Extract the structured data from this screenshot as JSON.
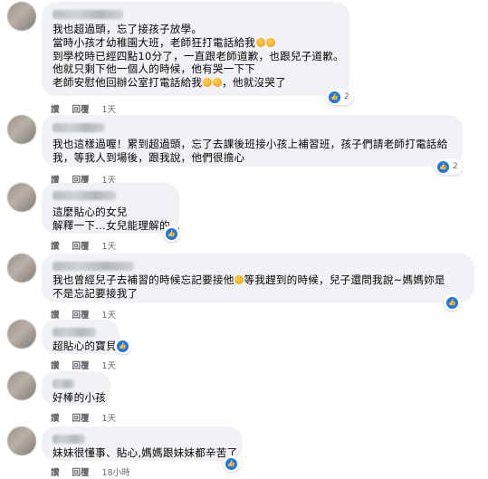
{
  "comments": [
    {
      "lines": [
        "我也超過頭，忘了接孩子放學。",
        "當時小孩才幼稚園大班，老師狂打電話給我",
        "到學校時已經四點10分了，一直跟老師道歉，也跟兒子道歉。",
        "他就只剩下他一個人的時候，他有哭一下下",
        "老師安慰他回辦公室打電話給我"
      ],
      "line_suffix": [
        "",
        "",
        "",
        "",
        "，他就沒哭了"
      ],
      "emoji_counts": [
        0,
        2,
        0,
        0,
        2
      ],
      "reaction_count": "2",
      "actions": {
        "like": "讚",
        "reply": "回覆",
        "time": "1天"
      }
    },
    {
      "lines": [
        "我也這樣過喔！累到超過頭，忘了去課後班接小孩上補習班，孩子們請老師打電話給",
        "我，等我人到場後，跟我說，他們很擔心"
      ],
      "reaction_count": "2",
      "actions": {
        "like": "讚",
        "reply": "回覆",
        "time": "1天"
      }
    },
    {
      "lines": [
        "這麼貼心的女兒",
        "解釋一下…女兒能理解的…"
      ],
      "reaction_count": "",
      "actions": {
        "like": "讚",
        "reply": "回覆",
        "time": "1天"
      }
    },
    {
      "lines": [
        "我也曾經兒子去補習的時候忘記要接他",
        "不是忘記要接我了"
      ],
      "line_suffix": [
        "等我趕到的時候，兒子還問我說~媽媽妳是",
        ""
      ],
      "emoji_counts": [
        1,
        0
      ],
      "reaction_count": "",
      "actions": {
        "like": "讚",
        "reply": "回覆",
        "time": "1天"
      }
    },
    {
      "lines": [
        "超貼心的寶貝"
      ],
      "reaction_count": "",
      "actions": {
        "like": "讚",
        "reply": "回覆",
        "time": "1天"
      }
    },
    {
      "lines": [
        "好棒的小孩"
      ],
      "reaction_count": "",
      "actions": {
        "like": "讚",
        "reply": "回覆",
        "time": "1天"
      }
    },
    {
      "lines": [
        "妹妹很懂事、貼心,媽媽跟妹妹都辛苦了"
      ],
      "reaction_count": "",
      "actions": {
        "like": "讚",
        "reply": "回覆",
        "time": "18小時"
      }
    }
  ]
}
